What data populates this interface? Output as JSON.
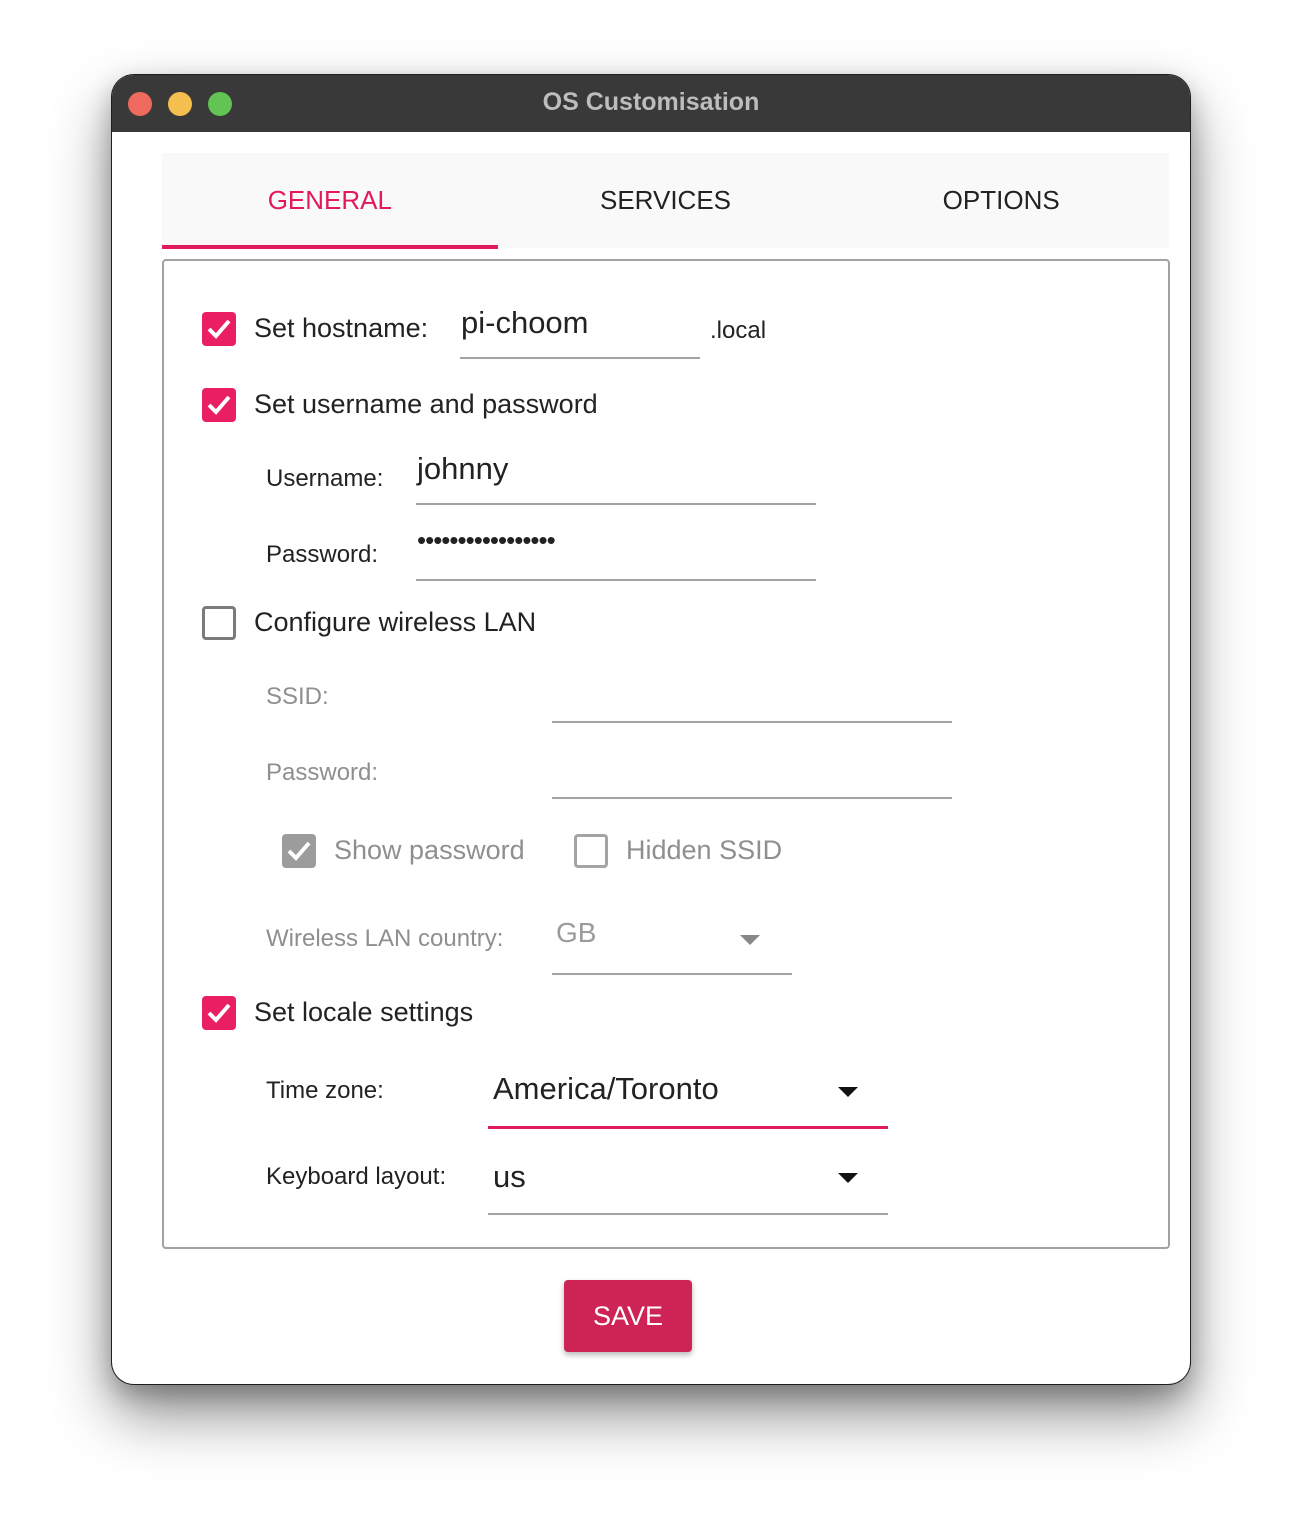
{
  "window": {
    "title": "OS Customisation"
  },
  "tabs": [
    {
      "label": "GENERAL",
      "active": true
    },
    {
      "label": "SERVICES",
      "active": false
    },
    {
      "label": "OPTIONS",
      "active": false
    }
  ],
  "colors": {
    "accent": "#e91e63",
    "save_button": "#cd2455",
    "titlebar": "#393939"
  },
  "general": {
    "hostname": {
      "checkbox_label": "Set hostname:",
      "checked": true,
      "value": "pi-choom",
      "suffix": ".local"
    },
    "user": {
      "checkbox_label": "Set username and password",
      "checked": true,
      "username_label": "Username:",
      "username_value": "johnny",
      "password_label": "Password:",
      "password_value": "•••••••••••••••••"
    },
    "wireless": {
      "checkbox_label": "Configure wireless LAN",
      "checked": false,
      "ssid_label": "SSID:",
      "ssid_value": "",
      "password_label": "Password:",
      "password_value": "",
      "show_password_label": "Show password",
      "show_password_checked": true,
      "hidden_ssid_label": "Hidden SSID",
      "hidden_ssid_checked": false,
      "country_label": "Wireless LAN country:",
      "country_value": "GB"
    },
    "locale": {
      "checkbox_label": "Set locale settings",
      "checked": true,
      "timezone_label": "Time zone:",
      "timezone_value": "America/Toronto",
      "keyboard_label": "Keyboard layout:",
      "keyboard_value": "us"
    }
  },
  "actions": {
    "save_label": "SAVE"
  }
}
